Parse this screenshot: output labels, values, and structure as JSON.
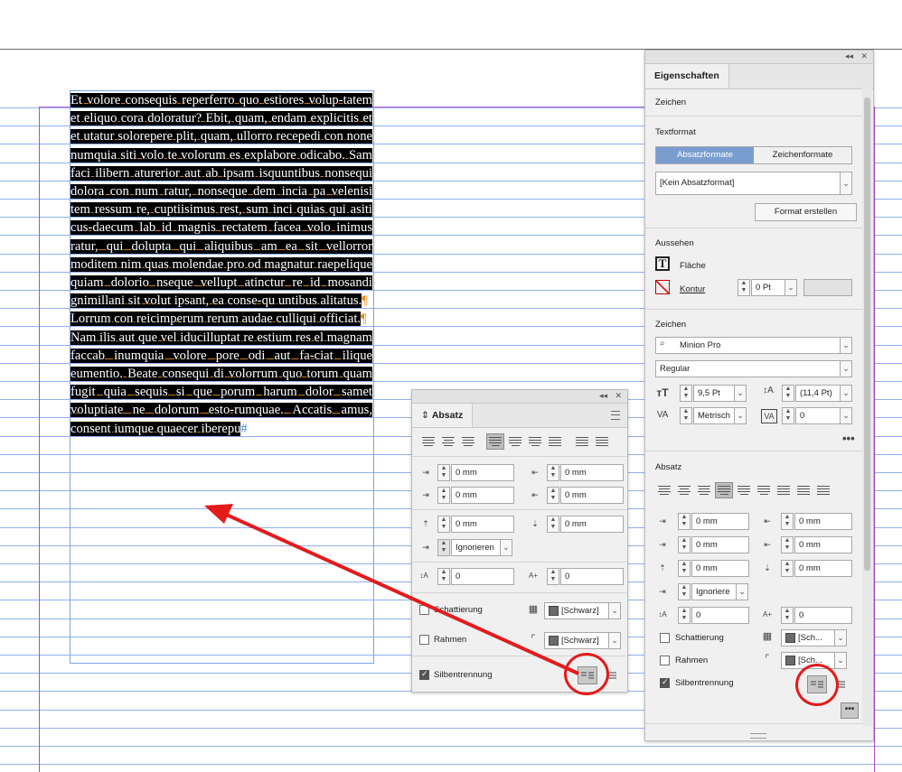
{
  "document_text": {
    "para1": "Et volore consequis reperferro quo estiores volup-tatem et eliquo cora doloratur? Ebit, quam, endam explicitis et et utatur solorepere plit, quam, ullorro recepedi con none numquia siti volo te volorum es explabore odicabo. Sam faci ilibern aturerior aut ab ipsam isquuntibus nonsequi dolora con num ratur, nonseque dem incia pa velenisi tem ressum re, cuptiisimus rest, sum inci quias qui asiti cus-daecum lab id magnis rectatem facea volo inimus ratur, qui dolupta qui aliquibus am ea sit vellorror moditem nim quas molendae pro od magnatur raepelique quiam dolorio nseque vellupt atinctur re id mosandi gnimillani sit volut ipsant, ea conse-qu untibus alitatus.",
    "para2": "Lorrum con reicimperum rerum audae culliqui officiat.",
    "para3": "Nam ilis aut que vel iducilluptat re estium res el magnam faccab inumquia volore pore odi aut fa-ciat ilique eumentio. Beate consequi di volorrum quo torum quam fugit quia sequis si que porum harum dolor samet voluptiate ne dolorum esto-rumquae. Accatis amus, consent iumque quaecer iberepu",
    "para_mark": "¶",
    "end_mark": "#"
  },
  "absatz_panel": {
    "title": "Absatz",
    "collapse_icon": "double-chevron-left-icon",
    "close_icon": "close-icon",
    "fields": {
      "left_indent": "0 mm",
      "right_indent": "0 mm",
      "first_line_indent": "0 mm",
      "last_line_right_indent": "0 mm",
      "space_before": "0 mm",
      "space_after": "0 mm",
      "align_to_grid": "Ignorieren",
      "dropcap_lines": "0",
      "dropcap_chars": "0"
    },
    "shading_label": "Schattierung",
    "shading_color": "[Schwarz]",
    "border_label": "Rahmen",
    "border_color": "[Schwarz]",
    "hyphenation_label": "Silbentrennung",
    "hyphenation_checked": true
  },
  "properties_panel": {
    "title": "Eigenschaften",
    "section_zeichen_top": "Zeichen",
    "section_textformat": "Textformat",
    "tab_absatzformate": "Absatzformate",
    "tab_zeichenformate": "Zeichenformate",
    "paragraph_style": "[Kein Absatzformat]",
    "create_style_button": "Format erstellen",
    "section_aussehen": "Aussehen",
    "fill_label": "Fläche",
    "stroke_label": "Kontur",
    "stroke_weight": "0 Pt",
    "section_zeichen": "Zeichen",
    "font_family": "Minion Pro",
    "font_style": "Regular",
    "font_size": "9,5 Pt",
    "leading": "(11,4 Pt)",
    "kerning": "Metrisch",
    "tracking": "0",
    "more_icon": "ellipsis-icon",
    "section_absatz": "Absatz",
    "left_indent": "0 mm",
    "right_indent": "0 mm",
    "first_line_indent": "0 mm",
    "last_line_right_indent": "0 mm",
    "space_before": "0 mm",
    "space_after": "0 mm",
    "align_to_grid": "Ignoriere",
    "dropcap_lines": "0",
    "dropcap_chars": "0",
    "shading_label": "Schattierung",
    "shading_color": "[Sch...",
    "border_label": "Rahmen",
    "border_color": "[Sch...",
    "hyphenation_label": "Silbentrennung",
    "hyphenation_checked": true
  },
  "colors": {
    "highlight_text_bg": "#000000",
    "baseline_grid": "#8fb0f2",
    "margin_guide": "#b04ec6",
    "paragraph_mark": "#e7891f",
    "annotation": "#e31b1b",
    "selected_tab": "#7a9dd0"
  }
}
